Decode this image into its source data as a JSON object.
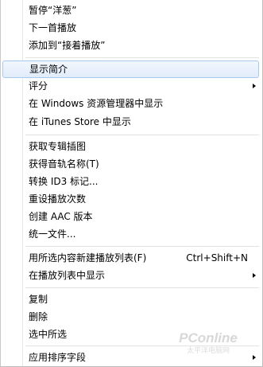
{
  "menu": {
    "items": [
      {
        "label": "暂停“洋葱”"
      },
      {
        "label": "下一首播放"
      },
      {
        "label": "添加到“接着播放”"
      },
      {
        "label": "显示简介"
      },
      {
        "label": "评分"
      },
      {
        "label": "在 Windows 资源管理器中显示"
      },
      {
        "label": "在 iTunes Store 中显示"
      },
      {
        "label": "获取专辑插图"
      },
      {
        "label": "获得音轨名称(T)"
      },
      {
        "label": "转换 ID3 标记..."
      },
      {
        "label": "重设播放次数"
      },
      {
        "label": "创建 AAC 版本"
      },
      {
        "label": "统一文件..."
      },
      {
        "label": "用所选内容新建播放列表(F)",
        "shortcut": "Ctrl+Shift+N"
      },
      {
        "label": "在播放列表中显示"
      },
      {
        "label": "复制"
      },
      {
        "label": "删除"
      },
      {
        "label": "选中所选"
      },
      {
        "label": "应用排序字段"
      }
    ]
  },
  "watermark": {
    "brand": "PConline",
    "sub": "太平洋电脑网"
  }
}
